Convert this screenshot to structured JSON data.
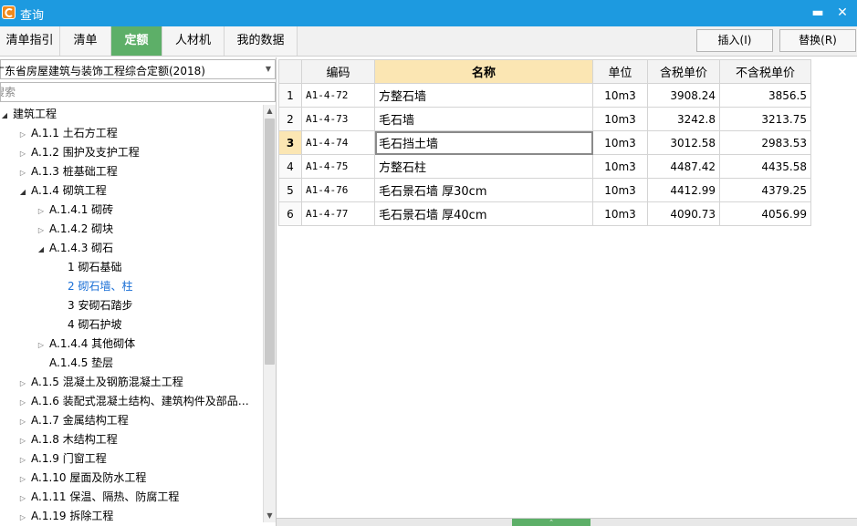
{
  "window": {
    "title": "查询",
    "minimize": "▬",
    "close": "✕"
  },
  "tabs": [
    {
      "label": "清单指引",
      "active": false
    },
    {
      "label": "清单",
      "active": false
    },
    {
      "label": "定额",
      "active": true
    },
    {
      "label": "人材机",
      "active": false
    },
    {
      "label": "我的数据",
      "active": false
    }
  ],
  "toolbar": {
    "insert_label": "插入(I)",
    "replace_label": "替换(R)"
  },
  "left": {
    "dropdown_value": "广东省房屋建筑与装饰工程综合定额(2018)",
    "search_placeholder": "搜索"
  },
  "tree": [
    {
      "label": "建筑工程",
      "level": 0,
      "state": "expanded"
    },
    {
      "label": "A.1.1 土石方工程",
      "level": 1,
      "state": "collapsed"
    },
    {
      "label": "A.1.2 围护及支护工程",
      "level": 1,
      "state": "collapsed"
    },
    {
      "label": "A.1.3 桩基础工程",
      "level": 1,
      "state": "collapsed"
    },
    {
      "label": "A.1.4 砌筑工程",
      "level": 1,
      "state": "expanded"
    },
    {
      "label": "A.1.4.1 砌砖",
      "level": 2,
      "state": "collapsed"
    },
    {
      "label": "A.1.4.2 砌块",
      "level": 2,
      "state": "collapsed"
    },
    {
      "label": "A.1.4.3 砌石",
      "level": 2,
      "state": "expanded"
    },
    {
      "label": "1 砌石基础",
      "level": 3,
      "state": "leaf"
    },
    {
      "label": "2 砌石墙、柱",
      "level": 3,
      "state": "leaf",
      "selected": true
    },
    {
      "label": "3 安砌石踏步",
      "level": 3,
      "state": "leaf"
    },
    {
      "label": "4 砌石护坡",
      "level": 3,
      "state": "leaf"
    },
    {
      "label": "A.1.4.4 其他砌体",
      "level": 2,
      "state": "collapsed"
    },
    {
      "label": "A.1.4.5 垫层",
      "level": 2,
      "state": "leaf"
    },
    {
      "label": "A.1.5 混凝土及钢筋混凝土工程",
      "level": 1,
      "state": "collapsed"
    },
    {
      "label": "A.1.6 装配式混凝土结构、建筑构件及部品…",
      "level": 1,
      "state": "collapsed"
    },
    {
      "label": "A.1.7 金属结构工程",
      "level": 1,
      "state": "collapsed"
    },
    {
      "label": "A.1.8 木结构工程",
      "level": 1,
      "state": "collapsed"
    },
    {
      "label": "A.1.9 门窗工程",
      "level": 1,
      "state": "collapsed"
    },
    {
      "label": "A.1.10 屋面及防水工程",
      "level": 1,
      "state": "collapsed"
    },
    {
      "label": "A.1.11 保温、隔热、防腐工程",
      "level": 1,
      "state": "collapsed"
    },
    {
      "label": "A.1.19 拆除工程",
      "level": 1,
      "state": "collapsed"
    }
  ],
  "table": {
    "columns": [
      "",
      "编码",
      "名称",
      "单位",
      "含税单价",
      "不含税单价"
    ],
    "sorted_column": 2,
    "current_row": 2,
    "rows": [
      {
        "num": "1",
        "code": "A1-4-72",
        "name": "方整石墙",
        "unit": "10m3",
        "price_tax": "3908.24",
        "price_notax": "3856.5"
      },
      {
        "num": "2",
        "code": "A1-4-73",
        "name": "毛石墙",
        "unit": "10m3",
        "price_tax": "3242.8",
        "price_notax": "3213.75"
      },
      {
        "num": "3",
        "code": "A1-4-74",
        "name": "毛石挡土墙",
        "unit": "10m3",
        "price_tax": "3012.58",
        "price_notax": "2983.53"
      },
      {
        "num": "4",
        "code": "A1-4-75",
        "name": "方整石柱",
        "unit": "10m3",
        "price_tax": "4487.42",
        "price_notax": "4435.58"
      },
      {
        "num": "5",
        "code": "A1-4-76",
        "name": "毛石景石墙 厚30cm",
        "unit": "10m3",
        "price_tax": "4412.99",
        "price_notax": "4379.25"
      },
      {
        "num": "6",
        "code": "A1-4-77",
        "name": "毛石景石墙 厚40cm",
        "unit": "10m3",
        "price_tax": "4090.73",
        "price_notax": "4056.99"
      }
    ]
  },
  "colors": {
    "titlebar": "#1d9ae0",
    "active_tab": "#5daf68",
    "header_highlight": "#fbe6b3",
    "selected_text": "#1a6fd6"
  },
  "icons": {
    "app": "app-logo-icon",
    "dropdown": "chevron-down-icon",
    "expand": "triangle-icon",
    "scroll_up": "arrow-up-icon",
    "scroll_down": "arrow-down-icon",
    "grip": "chevron-up-icon"
  }
}
